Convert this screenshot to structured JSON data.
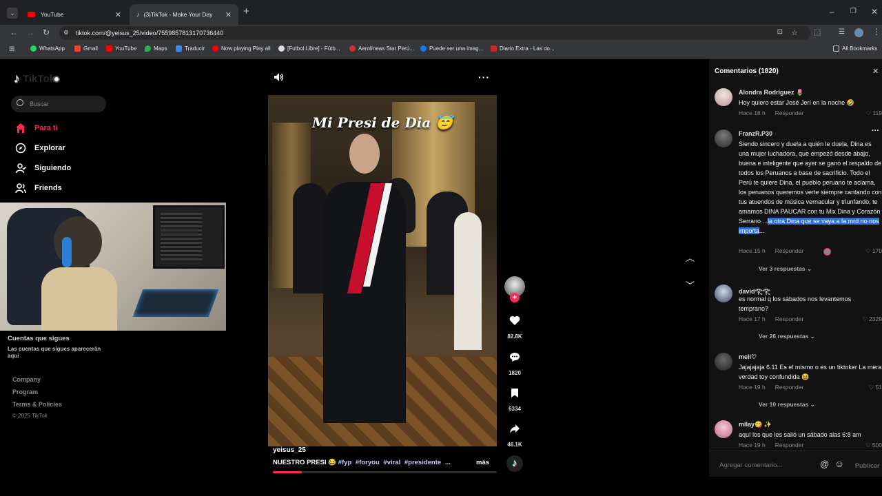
{
  "browser": {
    "tabs": [
      {
        "title": "YouTube",
        "active": false
      },
      {
        "title": "(3)TikTok - Make Your Day",
        "active": true
      }
    ],
    "url": "tiktok.com/@yeisus_25/video/7559857813170736440",
    "bookmarks": [
      {
        "label": "WhatsApp",
        "color": "#25d366"
      },
      {
        "label": "Gmail",
        "color": "#ea4335"
      },
      {
        "label": "YouTube",
        "color": "#ff0000"
      },
      {
        "label": "Maps",
        "color": "#34a853"
      },
      {
        "label": "Traducir",
        "color": "#4285f4"
      },
      {
        "label": "Now playing Play all",
        "color": "#ff0000"
      },
      {
        "label": "[Futbol Libre] - Fútb...",
        "color": "#dddddd"
      },
      {
        "label": "Aerolíneas Star Perú...",
        "color": "#d32f2f"
      },
      {
        "label": "Puede ser una imag...",
        "color": "#1877f2"
      },
      {
        "label": "Diario Extra - Las do...",
        "color": "#c62828"
      }
    ],
    "all_bookmarks": "All Bookmarks"
  },
  "sidebar": {
    "logo": "TikTok",
    "search_placeholder": "Buscar",
    "nav": [
      {
        "label": "Para ti",
        "active": true
      },
      {
        "label": "Explorar",
        "active": false
      },
      {
        "label": "Siguiendo",
        "active": false
      },
      {
        "label": "Friends",
        "active": false
      }
    ],
    "following_title": "Cuentas que sigues",
    "following_desc": "Las cuentas que sigues aparecerán aquí",
    "footer": [
      "Company",
      "Program",
      "Terms & Policies"
    ],
    "copyright": "© 2025 TikTok"
  },
  "video": {
    "overlay_title": "Mi Presi de Dia 😇",
    "author": "yeisus_25",
    "caption": "NUESTRO PRESI 😂",
    "hashtags": [
      "#fyp",
      "#foryou",
      "#viral",
      "#presidente"
    ],
    "ellipsis": "...",
    "more": "más"
  },
  "actions": {
    "likes": "82.8K",
    "comments": "1820",
    "saves": "6334",
    "shares": "46.1K"
  },
  "comments_panel": {
    "title": "Comentarios (1820)",
    "input_placeholder": "Agregar comentario...",
    "publish": "Publicar",
    "reply_label": "Responder",
    "items": [
      {
        "user": "Alondra Rodríguez 🌷",
        "text": "Hoy quiero estar José Jerí en la noche 🤣",
        "time": "Hace 18 h",
        "likes": "119"
      },
      {
        "user": "FranzR.P30",
        "text_plain": "Siendo sincero y duela a quién le duela, Dina es una mujer luchadora, que empezó desde abajo, buena e inteligente que ayer se ganó el respaldo de todos los Peruanos a base de sacrificio. Todo el Perú te quiere Dina, el pueblo peruano te aclama, los peruanos queremos verte siempre cantando con tus atuendos de música vernacular y triunfando, te amamos DINA PAUCAR con tu Mix Dina y Corazón Serrano ...",
        "text_highlight": "la otra Dina que se vaya a la mrd no nos importa",
        "text_tail": "...",
        "time": "Hace 15 h",
        "likes": "170",
        "replies": "Ver 3 respuestas"
      },
      {
        "user": "david𓂀𓂀",
        "text": "es normal q los sábados nos levantemos temprano?",
        "time": "Hace 17 h",
        "likes": "2329",
        "replies": "Ver 26 respuestas"
      },
      {
        "user": "meli♡",
        "text": "Jajajajaja 6.11 Es el mismo o es un tiktoker La mera verdad toy confundida 😆",
        "time": "Hace 19 h",
        "likes": "51",
        "replies": "Ver 10 respuestas"
      },
      {
        "user": "mllay😋 ✨",
        "text": "aquí los que les salió un sábado alas 6:8 am",
        "time": "Hace 19 h",
        "likes": "500"
      }
    ]
  },
  "colors": {
    "accent": "#fe2c55",
    "highlight": "#2f6fd6"
  }
}
